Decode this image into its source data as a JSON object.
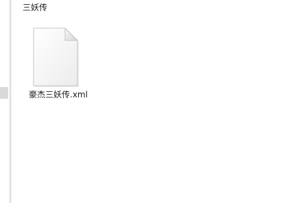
{
  "header": {
    "folder_title": "三妖传"
  },
  "files": [
    {
      "name": "豪杰三妖传.xml",
      "icon": "document-icon"
    }
  ],
  "colors": {
    "background": "#ffffff",
    "text": "#1a1a1a",
    "divider": "#e3e3e3"
  }
}
